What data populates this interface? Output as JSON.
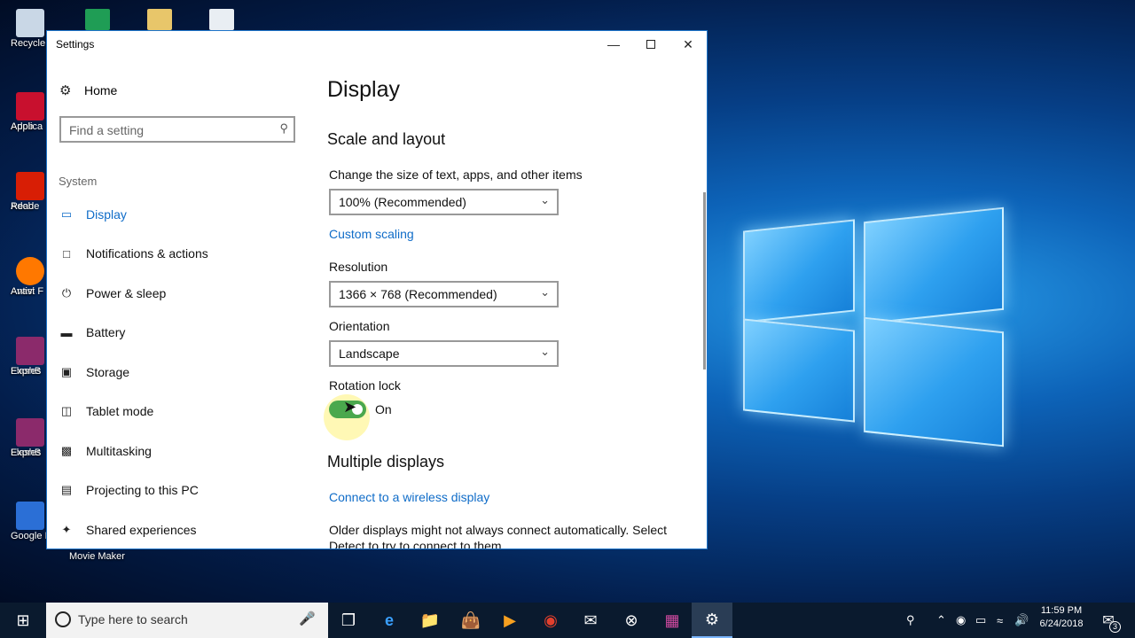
{
  "desktop": {
    "icons": [
      {
        "label_line1": "Recycle",
        "label_line2": "",
        "color": "#c9d7e6"
      },
      {
        "label_line1": "Adob",
        "label_line2": "Applica",
        "color": "#c8102e"
      },
      {
        "label_line1": "Adob",
        "label_line2": "Reade",
        "color": "#d81e05"
      },
      {
        "label_line1": "Avast F",
        "label_line2": "Antivi",
        "color": "#ff7800"
      },
      {
        "label_line1": "FlashB",
        "label_line2": "Expres",
        "color": "#8b2a6b"
      },
      {
        "label_line1": "FlashB",
        "label_line2": "Expres",
        "color": "#8b2a6b"
      },
      {
        "label_line1": "Google I",
        "label_line2": "",
        "color": "#2b6fd6"
      }
    ],
    "movie_maker_label": "Movie Maker"
  },
  "window": {
    "title": "Settings",
    "minimize_icon": "minimize-icon",
    "maximize_icon": "maximize-icon",
    "close_icon": "close-icon"
  },
  "sidebar": {
    "home_label": "Home",
    "search_placeholder": "Find a setting",
    "section_label": "System",
    "items": [
      {
        "label": "Display",
        "icon": "monitor-icon",
        "active": true
      },
      {
        "label": "Notifications & actions",
        "icon": "message-icon",
        "active": false
      },
      {
        "label": "Power & sleep",
        "icon": "power-icon",
        "active": false
      },
      {
        "label": "Battery",
        "icon": "battery-icon",
        "active": false
      },
      {
        "label": "Storage",
        "icon": "storage-icon",
        "active": false
      },
      {
        "label": "Tablet mode",
        "icon": "tablet-icon",
        "active": false
      },
      {
        "label": "Multitasking",
        "icon": "multitasking-icon",
        "active": false
      },
      {
        "label": "Projecting to this PC",
        "icon": "projector-icon",
        "active": false
      },
      {
        "label": "Shared experiences",
        "icon": "shared-icon",
        "active": false
      }
    ]
  },
  "content": {
    "page_title": "Display",
    "scale_section_title": "Scale and layout",
    "scale_label": "Change the size of text, apps, and other items",
    "scale_value": "100% (Recommended)",
    "custom_scaling_link": "Custom scaling",
    "resolution_label": "Resolution",
    "resolution_value": "1366 × 768 (Recommended)",
    "orientation_label": "Orientation",
    "orientation_value": "Landscape",
    "rotation_lock_label": "Rotation lock",
    "rotation_lock_state": "On",
    "multiple_displays_title": "Multiple displays",
    "wireless_link": "Connect to a wireless display",
    "detect_text": "Older displays might not always connect automatically. Select Detect to try to connect to them."
  },
  "taskbar": {
    "search_placeholder": "Type here to search",
    "clock_time": "11:59 PM",
    "clock_date": "6/24/2018",
    "notification_count": "3"
  },
  "colors": {
    "accent": "#0f6cc8",
    "toggle_on": "#4aa84d",
    "taskbar": "#0a1a2e"
  }
}
